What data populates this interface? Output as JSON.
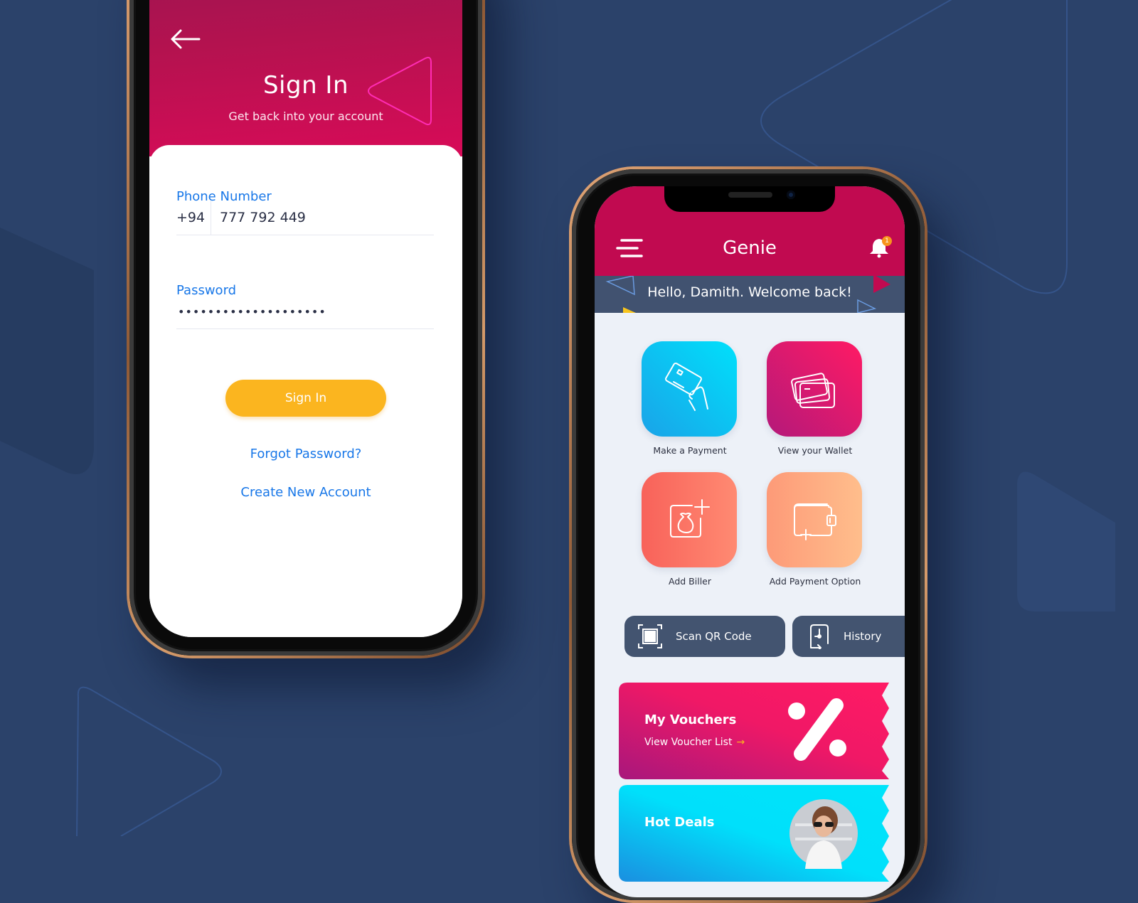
{
  "colors": {
    "background": "#2b426a",
    "brand_magenta": "#c10a50",
    "link_blue": "#1877e8",
    "button_yellow": "#fbb51f",
    "welcome_bar": "#415270",
    "badge_orange": "#f7941d"
  },
  "signin": {
    "back_icon": "arrow-left-icon",
    "title": "Sign In",
    "subtitle": "Get back into your account",
    "phone_label": "Phone Number",
    "country_code": "+94",
    "phone_value": "777 792 449",
    "password_label": "Password",
    "password_value": "••••••••••••••••••••",
    "signin_button": "Sign In",
    "forgot_link": "Forgot Password?",
    "create_link": "Create New Account"
  },
  "dashboard": {
    "app_title": "Genie",
    "menu_icon": "hamburger-menu-icon",
    "notification_icon": "bell-icon",
    "notification_count": "1",
    "welcome_message": "Hello, Damith. Welcome back!",
    "tiles": [
      {
        "label": "Make a Payment",
        "icon": "card-in-hand-icon",
        "color_from": "#1aa3e8",
        "color_to": "#00e0fb"
      },
      {
        "label": "View your Wallet",
        "icon": "cards-icon",
        "color_from": "#b4197a",
        "color_to": "#ff1a64"
      },
      {
        "label": "Add Biller",
        "icon": "money-bag-add-icon",
        "color_from": "#f8625a",
        "color_to": "#ff8a72"
      },
      {
        "label": "Add Payment Option",
        "icon": "wallet-add-icon",
        "color_from": "#fd9a78",
        "color_to": "#ffbe8c"
      }
    ],
    "quick_actions": [
      {
        "label": "Scan QR Code",
        "icon": "qr-scan-icon"
      },
      {
        "label": "History",
        "icon": "history-icon"
      }
    ],
    "promos": [
      {
        "title": "My Vouchers",
        "subtitle": "View Voucher List",
        "arrow": "→",
        "icon": "percent-icon"
      },
      {
        "title": "Hot Deals",
        "icon": "avatar-photo"
      }
    ]
  }
}
